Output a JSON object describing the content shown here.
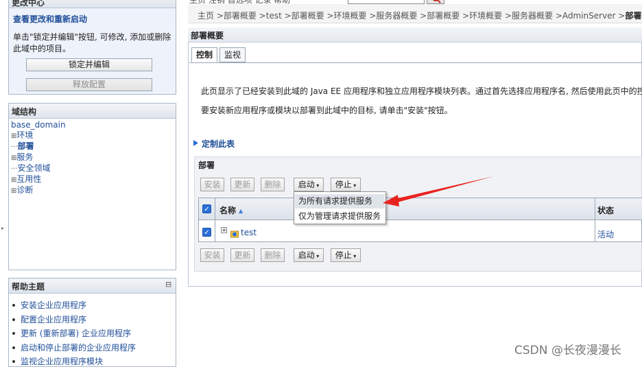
{
  "change_center": {
    "title": "更改中心",
    "link": "查看更改和重新启动",
    "description_line1": "单击\"锁定并编辑\"按钮, 可修改, 添加或删除",
    "description_line2": "此域中的项目。",
    "lock_button": "锁定并编辑",
    "release_button": "释放配置"
  },
  "domain_structure": {
    "title": "域结构",
    "root": "base_domain",
    "items": [
      {
        "prefix": "⊞",
        "label": "环境",
        "bold": false
      },
      {
        "prefix": "···",
        "label": "部署",
        "bold": true
      },
      {
        "prefix": "⊞",
        "label": "服务",
        "bold": false
      },
      {
        "prefix": "···",
        "label": "安全领域",
        "bold": false
      },
      {
        "prefix": "⊞",
        "label": "互用性",
        "bold": false
      },
      {
        "prefix": "⊞",
        "label": "诊断",
        "bold": false
      }
    ]
  },
  "help": {
    "title": "帮助主题",
    "collapse": "⊟",
    "items": [
      "安装企业应用程序",
      "配置企业应用程序",
      "更新 (重新部署) 企业应用程序",
      "启动和停止部署的企业应用程序",
      "监视企业应用程序模块"
    ]
  },
  "top": {
    "partial_text": "主页  注销  首选项  记录  帮助",
    "search_icon": "search-icon"
  },
  "breadcrumb": {
    "text": "主页 >部署概要 >test >部署概要 >环境概要 >服务器概要 >部署概要 >环境概要 >服务器概要 >AdminServer >",
    "current": "部署概要"
  },
  "page": {
    "title": "部署概要",
    "tabs": [
      "控制",
      "监视"
    ],
    "desc1": "此页显示了已经安装到此域的 Java EE 应用程序和独立应用程序模块列表。通过首先选择应用程序名, 然后使用此页中的控",
    "desc2": "要安装新应用程序或模块以部署到此域中的目标, 请单击\"安装\"按钮。",
    "customize": "定制此表",
    "section": "部署"
  },
  "toolbar": {
    "install": "安装",
    "update": "更新",
    "delete": "删除",
    "start": "启动",
    "stop": "停止"
  },
  "start_menu": {
    "items": [
      "为所有请求提供服务",
      "仅为管理请求提供服务"
    ]
  },
  "table": {
    "col_name": "名称",
    "col_status": "状态",
    "rows": [
      {
        "name": "test",
        "status": "活动"
      }
    ]
  },
  "watermark": "CSDN @长夜漫漫长",
  "colors": {
    "accent": "#1f4e99",
    "arrow": "#e8231f"
  }
}
